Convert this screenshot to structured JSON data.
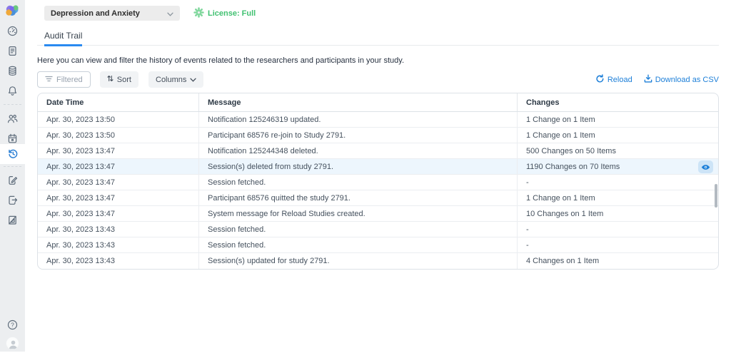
{
  "header": {
    "study_selector": "Depression and Anxiety",
    "license_label": "License: Full"
  },
  "tabs": [
    {
      "label": "Audit Trail",
      "active": true
    }
  ],
  "description": "Here you can view and filter the history of events related to the researchers and participants in your study.",
  "toolbar": {
    "filtered_label": "Filtered",
    "sort_label": "Sort",
    "columns_label": "Columns",
    "reload_label": "Reload",
    "download_label": "Download as CSV"
  },
  "sidebar": {
    "icons": [
      "brain-logo",
      "dashboard-gauge-icon",
      "report-document-icon",
      "database-icon",
      "notifications-bell-icon",
      "participants-users-icon",
      "calendar-icon",
      "audit-history-icon",
      "consent-edit-icon",
      "export-document-icon",
      "design-document-icon",
      "help-icon",
      "user-avatar-icon"
    ],
    "active_icon": "audit-history-icon"
  },
  "table": {
    "headers": [
      "Date Time",
      "Message",
      "Changes"
    ],
    "rows": [
      {
        "date": "Apr. 30, 2023 13:50",
        "message": "Notification 125246319 updated.",
        "changes": "1 Change on 1 Item"
      },
      {
        "date": "Apr. 30, 2023 13:50",
        "message": "Participant 68576 re-join to Study 2791.",
        "changes": "1 Change on 1 Item"
      },
      {
        "date": "Apr. 30, 2023 13:47",
        "message": "Notification 125244348 deleted.",
        "changes": "500 Changes on 50 Items"
      },
      {
        "date": "Apr. 30, 2023 13:47",
        "message": "Session(s) deleted from study 2791.",
        "changes": "1190 Changes on 70 Items",
        "highlighted": true,
        "eye": true
      },
      {
        "date": "Apr. 30, 2023 13:47",
        "message": "Session fetched.",
        "changes": "-"
      },
      {
        "date": "Apr. 30, 2023 13:47",
        "message": "Participant 68576 quitted the study 2791.",
        "changes": "1 Change on 1 Item"
      },
      {
        "date": "Apr. 30, 2023 13:47",
        "message": "System message for Reload Studies created.",
        "changes": "10 Changes on 1 Item"
      },
      {
        "date": "Apr. 30, 2023 13:43",
        "message": "Session fetched.",
        "changes": "-"
      },
      {
        "date": "Apr. 30, 2023 13:43",
        "message": "Session fetched.",
        "changes": "-"
      },
      {
        "date": "Apr. 30, 2023 13:43",
        "message": "Session(s) updated for study 2791.",
        "changes": "4 Changes on 1 Item"
      }
    ]
  },
  "colors": {
    "accent_blue": "#1d7fd8",
    "active_icon_blue": "#2b7fd4",
    "license_green": "#41c171",
    "license_icon_green": "#82d89e",
    "highlight_row": "#edf6fd",
    "sidebar_bg": "#eceef0",
    "tab_underline": "#2a8af0"
  }
}
